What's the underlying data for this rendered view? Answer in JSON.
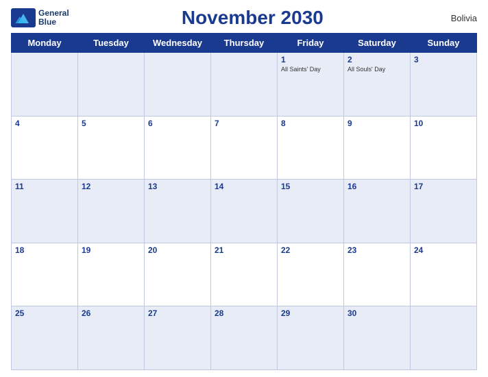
{
  "header": {
    "title": "November 2030",
    "country": "Bolivia",
    "logo_line1": "General",
    "logo_line2": "Blue"
  },
  "days_of_week": [
    "Monday",
    "Tuesday",
    "Wednesday",
    "Thursday",
    "Friday",
    "Saturday",
    "Sunday"
  ],
  "weeks": [
    [
      {
        "day": "",
        "events": []
      },
      {
        "day": "",
        "events": []
      },
      {
        "day": "",
        "events": []
      },
      {
        "day": "",
        "events": []
      },
      {
        "day": "1",
        "events": [
          "All Saints' Day"
        ]
      },
      {
        "day": "2",
        "events": [
          "All Souls' Day"
        ]
      },
      {
        "day": "3",
        "events": []
      }
    ],
    [
      {
        "day": "4",
        "events": []
      },
      {
        "day": "5",
        "events": []
      },
      {
        "day": "6",
        "events": []
      },
      {
        "day": "7",
        "events": []
      },
      {
        "day": "8",
        "events": []
      },
      {
        "day": "9",
        "events": []
      },
      {
        "day": "10",
        "events": []
      }
    ],
    [
      {
        "day": "11",
        "events": []
      },
      {
        "day": "12",
        "events": []
      },
      {
        "day": "13",
        "events": []
      },
      {
        "day": "14",
        "events": []
      },
      {
        "day": "15",
        "events": []
      },
      {
        "day": "16",
        "events": []
      },
      {
        "day": "17",
        "events": []
      }
    ],
    [
      {
        "day": "18",
        "events": []
      },
      {
        "day": "19",
        "events": []
      },
      {
        "day": "20",
        "events": []
      },
      {
        "day": "21",
        "events": []
      },
      {
        "day": "22",
        "events": []
      },
      {
        "day": "23",
        "events": []
      },
      {
        "day": "24",
        "events": []
      }
    ],
    [
      {
        "day": "25",
        "events": []
      },
      {
        "day": "26",
        "events": []
      },
      {
        "day": "27",
        "events": []
      },
      {
        "day": "28",
        "events": []
      },
      {
        "day": "29",
        "events": []
      },
      {
        "day": "30",
        "events": []
      },
      {
        "day": "",
        "events": []
      }
    ]
  ],
  "colors": {
    "header_bg": "#1a3a8f",
    "header_text": "#ffffff",
    "title_color": "#1a3a8f",
    "shaded_row": "#e8ecf7",
    "border_color": "#c0c8e0"
  }
}
